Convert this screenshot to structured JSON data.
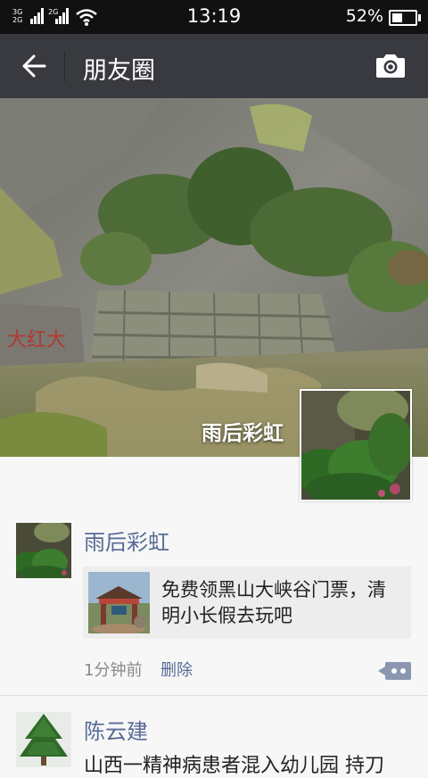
{
  "status_bar": {
    "network_top": "3G",
    "network_bottom": "2G",
    "network_label2": "2G",
    "time": "13:19",
    "battery_percent": "52%",
    "battery_level": 0.52,
    "icons": [
      "signal-icon",
      "wifi-icon",
      "battery-icon"
    ]
  },
  "nav": {
    "title": "朋友圈",
    "back_icon": "back-arrow-icon",
    "camera_icon": "camera-icon"
  },
  "cover": {
    "user_name": "雨后彩虹"
  },
  "posts": [
    {
      "author": "雨后彩虹",
      "share_text": "免费领黑山大峡谷门票，清明小长假去玩吧",
      "time": "1分钟前",
      "delete_label": "删除"
    },
    {
      "author": "陈云建",
      "text": "山西一精神病患者混入幼儿园 持刀"
    }
  ],
  "colors": {
    "nav_bg": "#393a3f",
    "link": "#576b95",
    "feed_bg": "#f7f7f7"
  }
}
